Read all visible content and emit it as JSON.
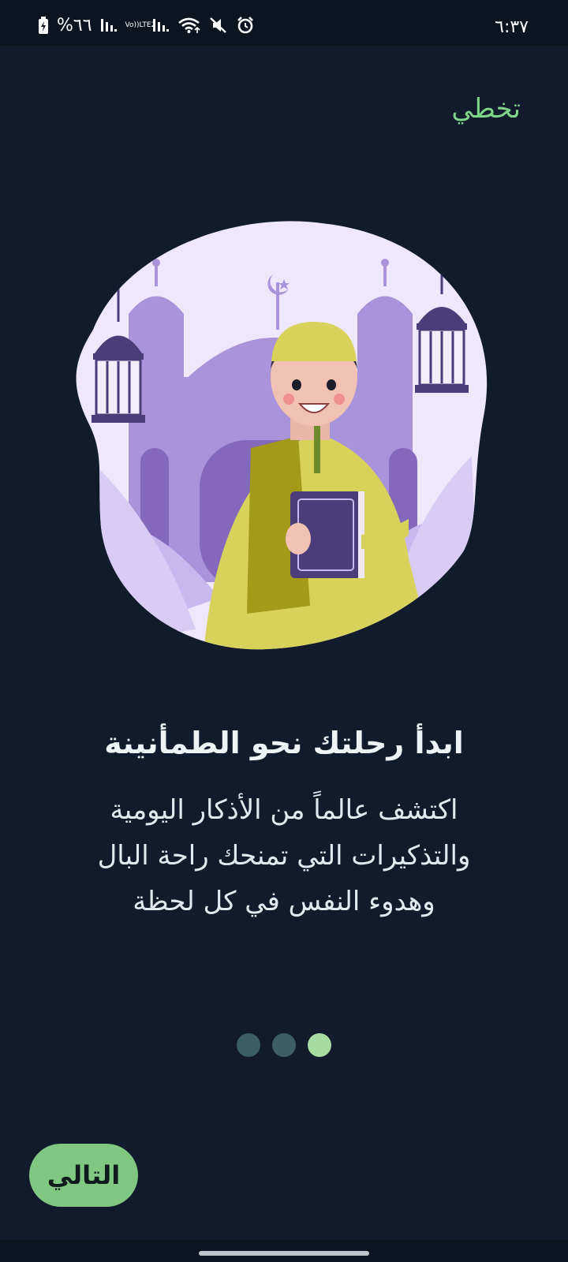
{
  "status_bar": {
    "time": "٦:٣٧",
    "battery": "%٦٦",
    "lte_label_top": "Vo))",
    "lte_label_bottom": "LTE2",
    "icons": [
      "battery-icon",
      "signal-icon",
      "lte-icon",
      "signal-icon",
      "wifi-icon",
      "mute-icon",
      "alarm-icon"
    ]
  },
  "onboarding": {
    "skip_label": "تخطي",
    "title": "ابدأ رحلتك نحو الطمأنينة",
    "description_lines": [
      "اكتشف عالماً من الأذكار اليومية",
      "والتذكيرات التي تمنحك راحة البال",
      "وهدوء النفس في كل لحظة"
    ],
    "page_count": 3,
    "active_page_index": 2,
    "next_label": "التالي"
  },
  "colors": {
    "background": "#111b2b",
    "accent": "#80c882",
    "skip_text": "#7ed488",
    "dot_inactive": "#3d5e67",
    "dot_active": "#a6dba2"
  }
}
